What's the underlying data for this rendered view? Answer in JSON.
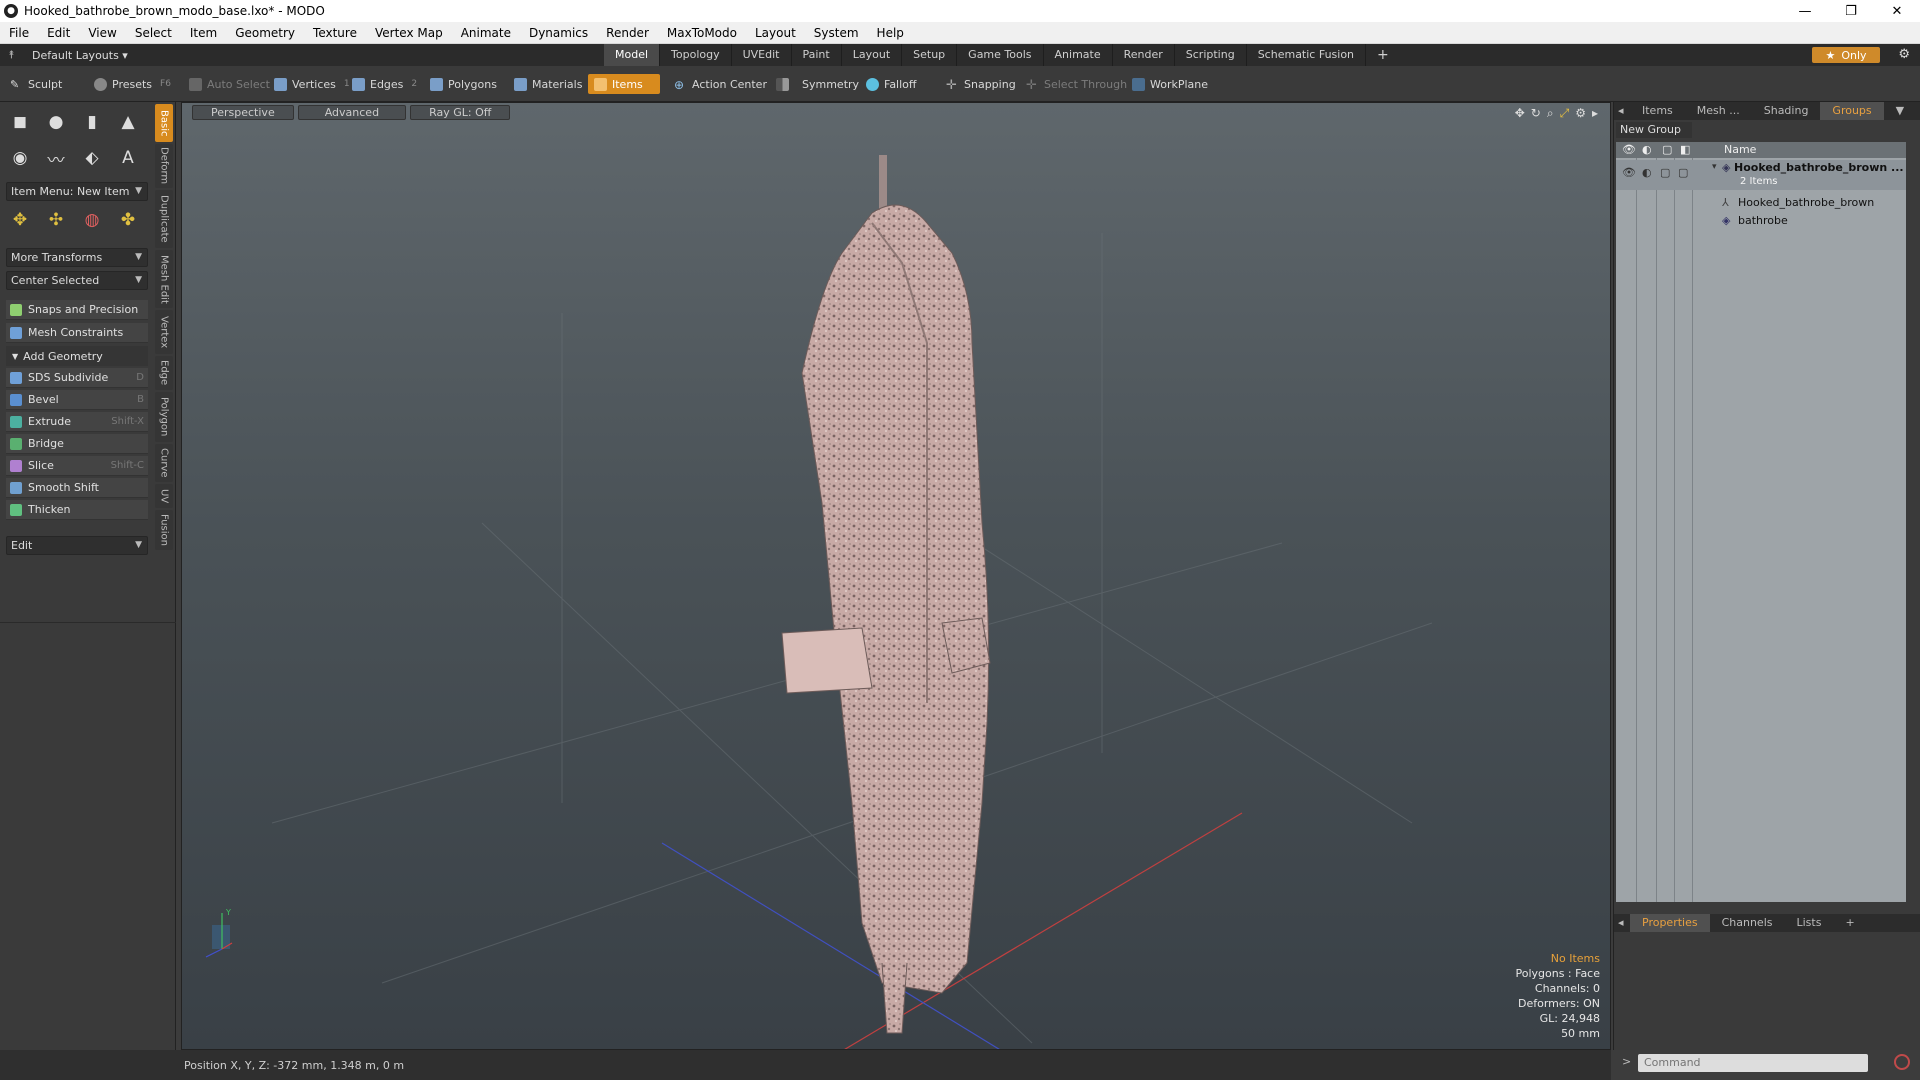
{
  "window": {
    "title": "Hooked_bathrobe_brown_modo_base.lxo* - MODO",
    "minimize": "—",
    "maximize": "❐",
    "close": "✕"
  },
  "menu": [
    "File",
    "Edit",
    "View",
    "Select",
    "Item",
    "Geometry",
    "Texture",
    "Vertex Map",
    "Animate",
    "Dynamics",
    "Render",
    "MaxToModo",
    "Layout",
    "System",
    "Help"
  ],
  "layoutbar": {
    "layouts_label": "Default Layouts ▾",
    "tabs": [
      "Model",
      "Topology",
      "UVEdit",
      "Paint",
      "Layout",
      "Setup",
      "Game Tools",
      "Animate",
      "Render",
      "Scripting",
      "Schematic Fusion"
    ],
    "active_tab": "Model",
    "add": "+",
    "only_label": "Only"
  },
  "toolbar": {
    "sculpt": "Sculpt",
    "presets": "Presets",
    "presets_key": "F6",
    "auto_select": "Auto Select",
    "vertices": "Vertices",
    "vertices_key": "1",
    "edges": "Edges",
    "edges_key": "2",
    "polygons": "Polygons",
    "materials": "Materials",
    "items": "Items",
    "action_center": "Action Center",
    "symmetry": "Symmetry",
    "falloff": "Falloff",
    "snapping": "Snapping",
    "select_through": "Select Through",
    "workplane": "WorkPlane"
  },
  "left": {
    "item_menu": "Item Menu: New Item",
    "more_transforms": "More Transforms",
    "center_selected": "Center Selected",
    "snaps": "Snaps and Precision",
    "mesh_constraints": "Mesh Constraints",
    "add_geometry": "Add Geometry",
    "tools": [
      {
        "label": "SDS Subdivide",
        "key": "D",
        "color": "#6fa0d8"
      },
      {
        "label": "Bevel",
        "key": "B",
        "color": "#5a8fd0"
      },
      {
        "label": "Extrude",
        "key": "Shift-X",
        "color": "#4cb0a0"
      },
      {
        "label": "Bridge",
        "key": "",
        "color": "#5ab070"
      },
      {
        "label": "Slice",
        "key": "Shift-C",
        "color": "#b080d0"
      },
      {
        "label": "Smooth Shift",
        "key": "",
        "color": "#70a0d0"
      },
      {
        "label": "Thicken",
        "key": "",
        "color": "#60c080"
      }
    ],
    "edit": "Edit",
    "side_tabs": [
      "Basic",
      "Deform",
      "Duplicate",
      "Mesh Edit",
      "Vertex",
      "Edge",
      "Polygon",
      "Curve",
      "UV",
      "Fusion"
    ]
  },
  "viewport": {
    "view_label": "Perspective",
    "shading_label": "Advanced",
    "raygl_label": "Ray GL: Off",
    "info": {
      "items": "No Items",
      "polygons": "Polygons : Face",
      "channels": "Channels: 0",
      "deformers": "Deformers: ON",
      "gl": "GL: 24,948",
      "scale": "50 mm"
    },
    "axis_y": "Y"
  },
  "status": {
    "position": "Position X, Y, Z:  -372 mm, 1.348 m, 0 m"
  },
  "right": {
    "tabs": [
      "Items",
      "Mesh ...",
      "Shading",
      "Groups"
    ],
    "active_tab": "Groups",
    "new_group": "New Group",
    "col_name": "Name",
    "group_name": "Hooked_bathrobe_brown ...",
    "group_count": "2 Items",
    "child1": "Hooked_bathrobe_brown",
    "child2": "bathrobe",
    "bottom_tabs": [
      "Properties",
      "Channels",
      "Lists"
    ],
    "bottom_active": "Properties",
    "bottom_add": "+",
    "command_placeholder": "Command"
  },
  "colors": {
    "accent": "#d88b1e",
    "viewport_top": "#5f676c",
    "viewport_bottom": "#394046"
  }
}
